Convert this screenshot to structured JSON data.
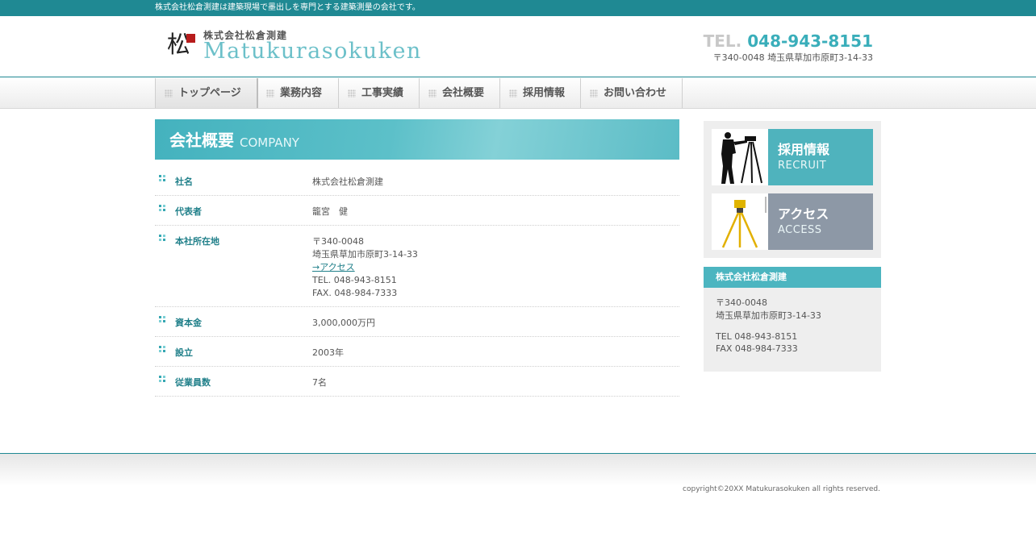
{
  "topbar": {
    "tagline": "株式会社松倉測建は建築現場で墨出しを専門とする建築測量の会社です。"
  },
  "header": {
    "logo_kanji": "松",
    "logo_sub": "株式会社松倉測建",
    "logo_main": "Matukurasokuken",
    "tel_label": "TEL.",
    "tel_number": "048-943-8151",
    "address": "〒340-0048 埼玉県草加市原町3-14-33"
  },
  "nav": {
    "items": [
      {
        "label": "トップページ"
      },
      {
        "label": "業務内容"
      },
      {
        "label": "工事実績"
      },
      {
        "label": "会社概要"
      },
      {
        "label": "採用情報"
      },
      {
        "label": "お問い合わせ"
      }
    ]
  },
  "section": {
    "title_ja": "会社概要",
    "title_en": "COMPANY"
  },
  "info": {
    "company": {
      "key": "社名",
      "value": "株式会社松倉測建"
    },
    "rep": {
      "key": "代表者",
      "value": "籠宮　健"
    },
    "office": {
      "key": "本社所在地",
      "postal": "〒340-0048",
      "address": "埼玉県草加市原町3-14-33",
      "access_link": "→アクセス",
      "tel": "TEL. 048-943-8151",
      "fax": "FAX. 048-984-7333"
    },
    "capital": {
      "key": "資本金",
      "value": "3,000,000万円"
    },
    "founded": {
      "key": "設立",
      "value": "2003年"
    },
    "employees": {
      "key": "従業員数",
      "value": "7名"
    }
  },
  "sidebar": {
    "recruit": {
      "ja": "採用情報",
      "en": "RECRUIT",
      "color": "#4fb3bd"
    },
    "access": {
      "ja": "アクセス",
      "en": "ACCESS",
      "color": "#8d98a6"
    },
    "company_box": {
      "title": "株式会社松倉測建",
      "postal": "〒340-0048",
      "address": "埼玉県草加市原町3-14-33",
      "tel": "TEL 048-943-8151",
      "fax": "FAX 048-984-7333"
    }
  },
  "footer": {
    "copyright": "copyright©20XX Matukurasokuken all rights reserved."
  },
  "colors": {
    "brand": "#1f8993",
    "accent": "#3aaeba"
  }
}
